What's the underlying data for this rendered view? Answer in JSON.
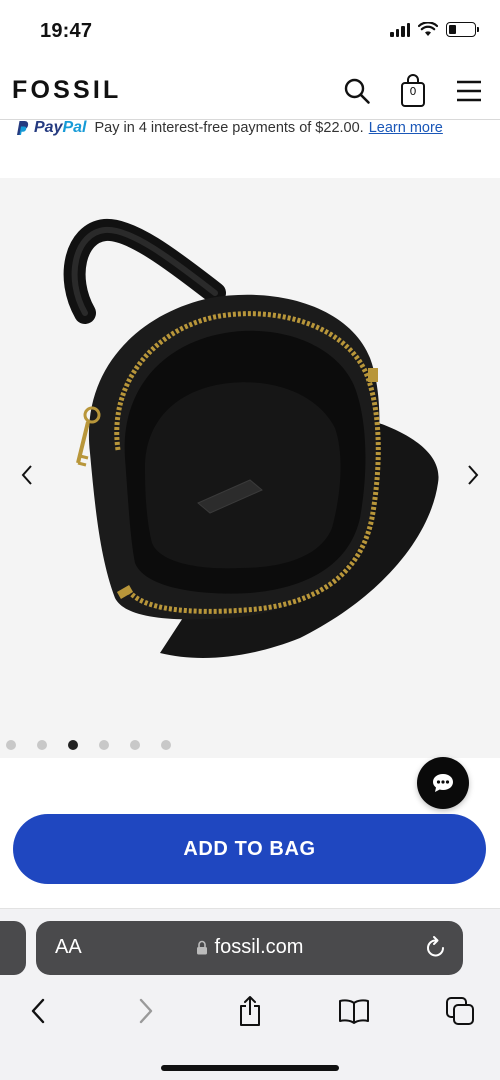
{
  "status_bar": {
    "time": "19:47"
  },
  "header": {
    "logo": "FOSSIL",
    "bag_count": "0"
  },
  "paypal": {
    "logo_pay": "Pay",
    "logo_pal": "Pal",
    "message": "Pay in 4 interest-free payments of $22.00.",
    "link": "Learn more"
  },
  "gallery": {
    "image_count": 6,
    "active_index": 2
  },
  "actions": {
    "add_to_bag": "ADD TO BAG"
  },
  "browser": {
    "text_size_label": "AA",
    "url": "fossil.com"
  },
  "colors": {
    "primary_button": "#1f47c0",
    "link": "#1a57b8",
    "paypal_dark": "#253b80",
    "paypal_light": "#179bd7"
  },
  "icons": [
    "search-icon",
    "shopping-bag-icon",
    "hamburger-menu-icon",
    "chevron-left-icon",
    "chevron-right-icon",
    "chat-icon",
    "lock-icon",
    "reload-icon",
    "back-icon",
    "forward-icon",
    "share-icon",
    "bookmarks-icon",
    "tabs-icon"
  ]
}
